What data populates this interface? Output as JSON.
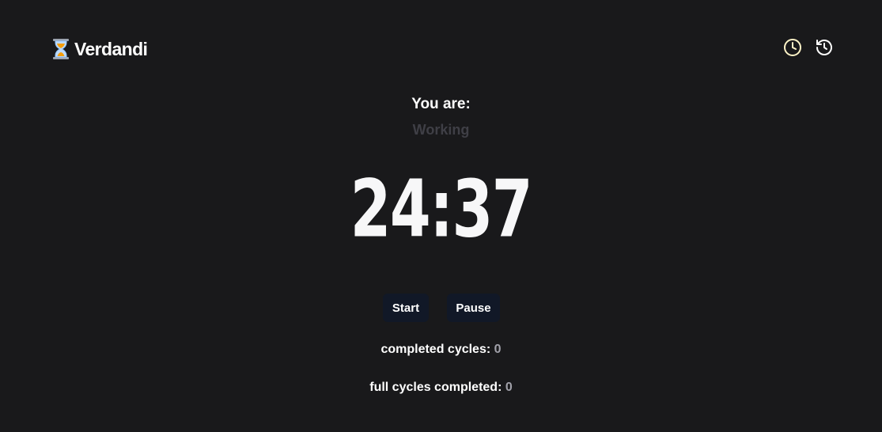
{
  "app": {
    "name": "Verdandi",
    "logo_icon": "hourglass-icon"
  },
  "header": {
    "actions": [
      {
        "icon": "clock-icon"
      },
      {
        "icon": "history-icon"
      }
    ],
    "icon_color": "#fef3c7"
  },
  "status": {
    "label": "You are:",
    "value": "Working"
  },
  "timer": {
    "display": "24:37"
  },
  "controls": {
    "start_label": "Start",
    "pause_label": "Pause"
  },
  "stats": {
    "completed_cycles_label": "completed cycles:",
    "completed_cycles_value": "0",
    "full_cycles_label": "full cycles completed:",
    "full_cycles_value": "0"
  },
  "colors": {
    "background": "#19191b",
    "button_bg": "#111827",
    "status_value": "#3f3f46",
    "stat_value": "#a1a1aa"
  }
}
